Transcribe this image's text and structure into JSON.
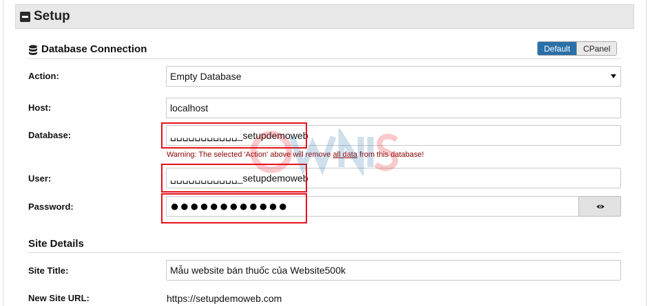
{
  "setup": {
    "title": "Setup"
  },
  "db_section": {
    "title": "Database Connection",
    "toggle": {
      "default_label": "Default",
      "cpanel_label": "CPanel"
    }
  },
  "action": {
    "label": "Action:",
    "value": "Empty Database"
  },
  "host": {
    "label": "Host:",
    "value": "localhost"
  },
  "database": {
    "label": "Database:",
    "value": "␣␣␣␣␣␣␣␣␣␣␣_setupdemoweb",
    "warning_pre": "Warning: The selected 'Action' above will remove ",
    "warning_link": "all data",
    "warning_post": " from this database!"
  },
  "user": {
    "label": "User:",
    "value": "␣␣␣␣␣␣␣␣␣␣␣_setupdemoweb"
  },
  "password": {
    "label": "Password:",
    "value": "●●●●●●●●●●●●"
  },
  "site_section": {
    "title": "Site Details"
  },
  "site_title": {
    "label": "Site Title:",
    "value": "Mẫu website bán thuốc của Website500k"
  },
  "site_url": {
    "label": "New Site URL:",
    "value": "https://setupdemoweb.com"
  },
  "colors": {
    "accent": "#2a70a8",
    "highlight": "#e5101a",
    "warning": "#8a0000"
  },
  "icons": {
    "collapse": "minus-square-icon",
    "database": "database-icon",
    "show_password": "eye-icon"
  }
}
